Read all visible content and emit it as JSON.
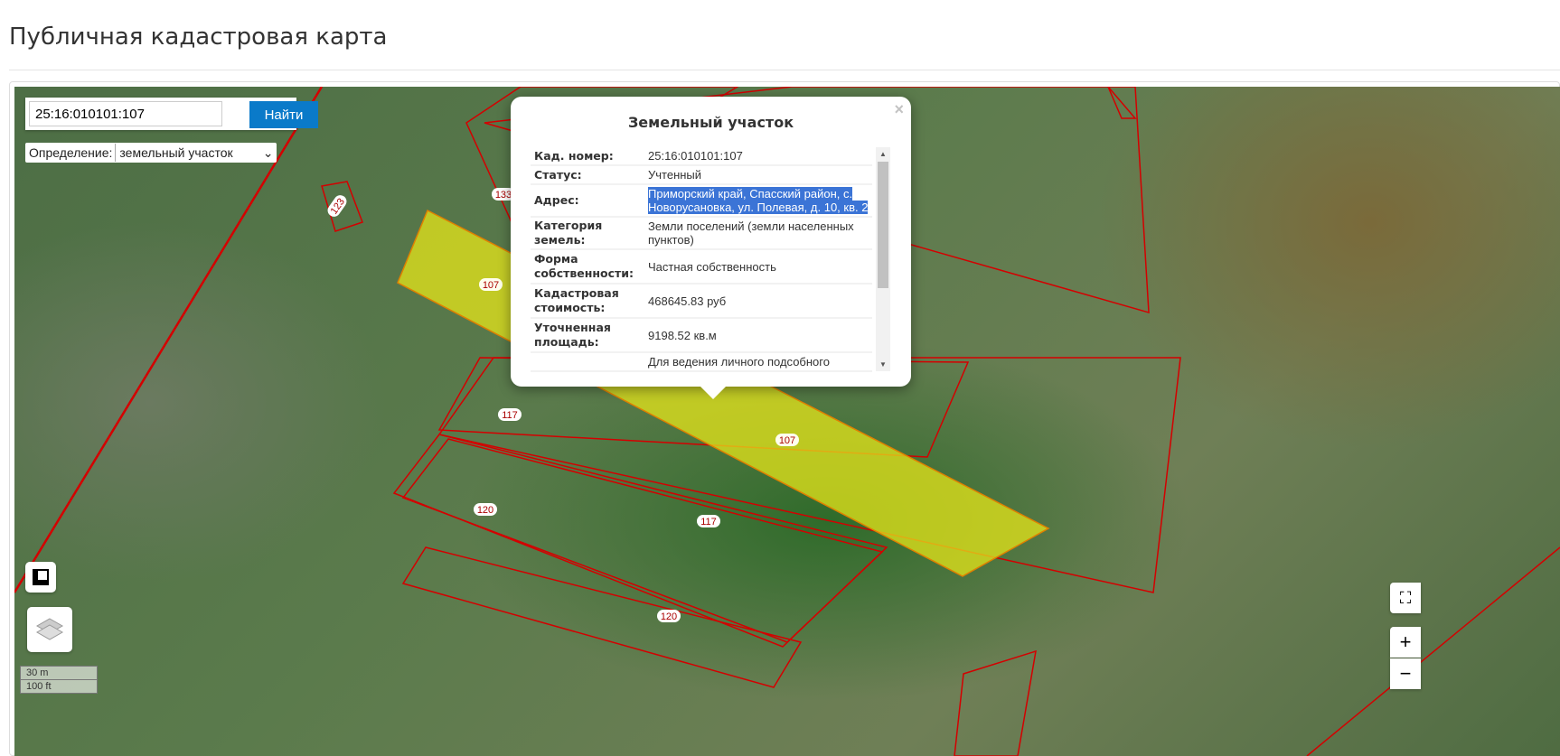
{
  "header": {
    "title": "Публичная кадастровая карта"
  },
  "search": {
    "value": "25:16:010101:107",
    "button": "Найти"
  },
  "definition": {
    "label": "Определение:",
    "selected": "земельный участок"
  },
  "popup": {
    "title": "Земельный участок",
    "close": "×",
    "rows": [
      {
        "key": "Кад. номер:",
        "value": "25:16:010101:107"
      },
      {
        "key": "Статус:",
        "value": "Учтенный"
      },
      {
        "key": "Адрес:",
        "value": "Приморский край, Спасский район, с. Новорусановка, ул. Полевая, д. 10, кв. 2"
      },
      {
        "key": "Категория земель:",
        "value": "Земли поселений (земли населенных пунктов)"
      },
      {
        "key": "Форма собственности:",
        "value": "Частная собственность"
      },
      {
        "key": "Кадастровая стоимость:",
        "value": "468645.83 руб"
      },
      {
        "key": "Уточненная площадь:",
        "value": "9198.52 кв.м"
      },
      {
        "key": "",
        "value": "Для ведения личного подсобного"
      }
    ]
  },
  "map": {
    "parcel_labels": [
      "107",
      "107",
      "117",
      "117",
      "120",
      "120",
      "123",
      "133"
    ],
    "scale": {
      "metric": "30 m",
      "imperial": "100 ft"
    },
    "zoom_in": "+",
    "zoom_out": "−"
  },
  "colors": {
    "accent": "#0a7ac9",
    "parcel_border": "#d00000",
    "selected_fill": "#e6e619"
  }
}
